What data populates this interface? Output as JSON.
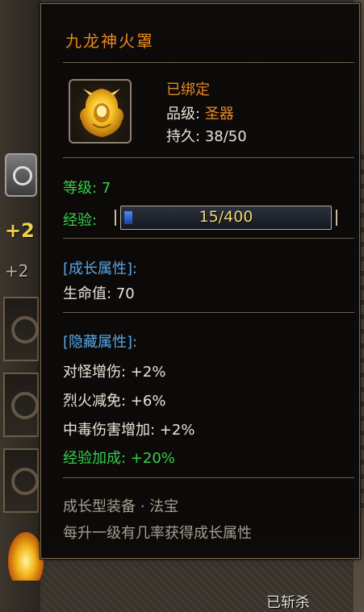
{
  "item": {
    "name": "九龙神火罩",
    "bound_status": "已绑定",
    "grade_label": "品级:",
    "grade_value": "圣器",
    "durability_label": "持久:",
    "durability_value": "38/50",
    "icon": "golden-dragon-helmet-icon"
  },
  "level": {
    "label": "等级:",
    "value": "7"
  },
  "experience": {
    "label": "经验:",
    "current": 15,
    "max": 400,
    "text": "15/400"
  },
  "growth_attributes": {
    "header": "[成长属性]:",
    "lines": [
      "生命值: 70"
    ]
  },
  "hidden_attributes": {
    "header": "[隐藏属性]:",
    "lines": [
      "对怪增伤: +2%",
      "烈火减免: +6%",
      "中毒伤害增加: +2%",
      "经验加成: +20%"
    ]
  },
  "footer": {
    "type": "成长型装备 · 法宝",
    "description": "每升一级有几率获得成长属性"
  },
  "background": {
    "bottom_label": "已斩杀",
    "plus_label": "+2",
    "plus_label_2": "+2"
  },
  "colors": {
    "title_orange": "#e8891f",
    "green": "#33d14b",
    "blue_header": "#58a7e8",
    "text": "#e9e2d6",
    "footer_gray": "#a59d90"
  }
}
